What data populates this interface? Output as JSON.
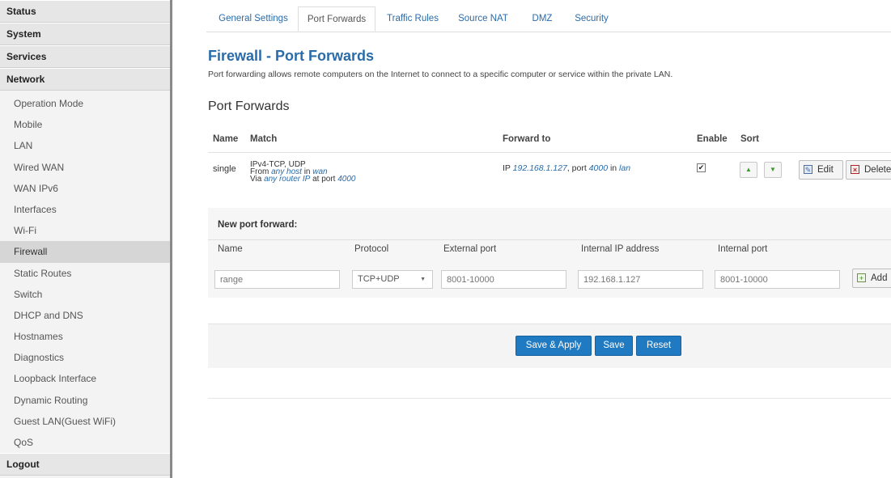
{
  "sidebar": {
    "main_top": [
      "Status",
      "System",
      "Services",
      "Network"
    ],
    "sub": [
      "Operation Mode",
      "Mobile",
      "LAN",
      "Wired WAN",
      "WAN IPv6",
      "Interfaces",
      "Wi-Fi",
      "Firewall",
      "Static Routes",
      "Switch",
      "DHCP and DNS",
      "Hostnames",
      "Diagnostics",
      "Loopback Interface",
      "Dynamic Routing",
      "Guest LAN(Guest WiFi)",
      "QoS"
    ],
    "logout": "Logout",
    "active_item": "Firewall"
  },
  "tabs": [
    "General Settings",
    "Port Forwards",
    "Traffic Rules",
    "Source NAT",
    "DMZ",
    "Security"
  ],
  "active_tab": "Port Forwards",
  "page": {
    "title": "Firewall - Port Forwards",
    "description": "Port forwarding allows remote computers on the Internet to connect to a specific computer or service within the private LAN.",
    "section_title": "Port Forwards"
  },
  "rules_table": {
    "headers": {
      "name": "Name",
      "match": "Match",
      "forward_to": "Forward to",
      "enable": "Enable",
      "sort": "Sort"
    },
    "rows": [
      {
        "name": "single",
        "match_proto": "IPv4-TCP, UDP",
        "match_from_prefix": "From ",
        "match_from_host": "any host",
        "match_in": " in ",
        "match_from_zone": "wan",
        "match_via_prefix": "Via ",
        "match_via_ip": "any router IP",
        "match_at_port": " at port ",
        "match_port": "4000",
        "fwd_ip_prefix": "IP ",
        "fwd_ip": "192.168.1.127",
        "fwd_port_prefix": ", port ",
        "fwd_port": "4000",
        "fwd_in": " in ",
        "fwd_zone": "lan",
        "enabled": true,
        "edit_label": "Edit",
        "delete_label": "Delete"
      }
    ]
  },
  "new_forward": {
    "title": "New port forward:",
    "headers": {
      "name": "Name",
      "protocol": "Protocol",
      "external_port": "External port",
      "internal_ip": "Internal IP address",
      "internal_port": "Internal port"
    },
    "placeholders": {
      "name": "range",
      "external_port": "8001-10000",
      "internal_ip": "192.168.1.127",
      "internal_port": "8001-10000"
    },
    "protocol_value": "TCP+UDP",
    "add_label": "Add"
  },
  "actions": {
    "save_apply": "Save & Apply",
    "save": "Save",
    "reset": "Reset"
  },
  "colors": {
    "accent": "#2a6ba9",
    "primary_button": "#1f7ac2",
    "sidebar_active": "#d6d6d6"
  }
}
